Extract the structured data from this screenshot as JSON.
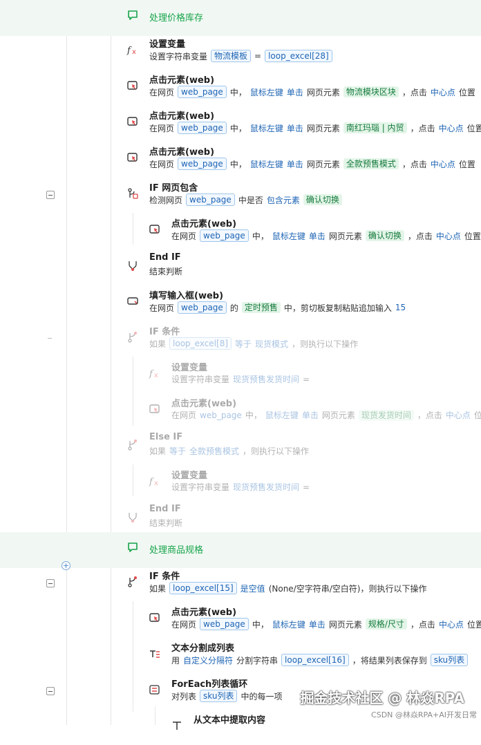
{
  "rows": [
    {
      "line": "56",
      "kind": "comment",
      "title": "处理价格库存"
    },
    {
      "line": "57",
      "title": "设置变量",
      "desc": [
        [
          "t",
          "设置字符串变量"
        ],
        [
          "v",
          "物流模板"
        ],
        [
          "t",
          "="
        ],
        [
          "v",
          "loop_excel[28]"
        ]
      ]
    },
    {
      "line": "58",
      "title": "点击元素(web)",
      "desc": [
        [
          "t",
          "在网页"
        ],
        [
          "v",
          "web_page"
        ],
        [
          "t",
          "中，"
        ],
        [
          "l",
          "鼠标左键"
        ],
        [
          "l",
          "单击"
        ],
        [
          "t",
          "网页元素"
        ],
        [
          "e",
          "物流模块区块"
        ],
        [
          "t",
          "，点击"
        ],
        [
          "l",
          "中心点"
        ],
        [
          "t",
          "位置"
        ]
      ]
    },
    {
      "line": "59",
      "title": "点击元素(web)",
      "desc": [
        [
          "t",
          "在网页"
        ],
        [
          "v",
          "web_page"
        ],
        [
          "t",
          "中，"
        ],
        [
          "l",
          "鼠标左键"
        ],
        [
          "l",
          "单击"
        ],
        [
          "t",
          "网页元素"
        ],
        [
          "e",
          "南红玛瑙 | 内贸"
        ],
        [
          "t",
          "，点击"
        ],
        [
          "l",
          "中心点"
        ],
        [
          "t",
          "位置"
        ]
      ]
    },
    {
      "line": "60",
      "title": "点击元素(web)",
      "desc": [
        [
          "t",
          "在网页"
        ],
        [
          "v",
          "web_page"
        ],
        [
          "t",
          "中，"
        ],
        [
          "l",
          "鼠标左键"
        ],
        [
          "l",
          "单击"
        ],
        [
          "t",
          "网页元素"
        ],
        [
          "e",
          "全款预售模式"
        ],
        [
          "t",
          "，点击"
        ],
        [
          "l",
          "中心点"
        ],
        [
          "t",
          "位置"
        ]
      ]
    },
    {
      "line": "61",
      "title": "IF 网页包含",
      "desc": [
        [
          "t",
          "检测网页"
        ],
        [
          "v",
          "web_page"
        ],
        [
          "t",
          "中是否"
        ],
        [
          "l",
          "包含元素"
        ],
        [
          "e",
          "确认切换"
        ]
      ]
    },
    {
      "line": "62",
      "title": "点击元素(web)",
      "desc": [
        [
          "t",
          "在网页"
        ],
        [
          "v",
          "web_page"
        ],
        [
          "t",
          "中，"
        ],
        [
          "l",
          "鼠标左键"
        ],
        [
          "l",
          "单击"
        ],
        [
          "t",
          "网页元素"
        ],
        [
          "e",
          "确认切换"
        ],
        [
          "t",
          "，点击"
        ],
        [
          "l",
          "中心点"
        ],
        [
          "t",
          "位置"
        ]
      ]
    },
    {
      "line": "63",
      "title": "End IF",
      "desc": [
        [
          "t",
          "结束判断"
        ]
      ]
    },
    {
      "line": "64",
      "title": "填写输入框(web)",
      "desc": [
        [
          "t",
          "在网页"
        ],
        [
          "v",
          "web_page"
        ],
        [
          "t",
          "的"
        ],
        [
          "e",
          "定时预售"
        ],
        [
          "t",
          "中，剪切板复制粘贴追加输入"
        ],
        [
          "l",
          "15"
        ]
      ]
    },
    {
      "line": "65",
      "title": "IF 条件",
      "desc": [
        [
          "t",
          "如果"
        ],
        [
          "v",
          "loop_excel[8]"
        ],
        [
          "l",
          "等于"
        ],
        [
          "l",
          "现货模式"
        ],
        [
          "t",
          "，则执行以下操作"
        ]
      ]
    },
    {
      "line": "66",
      "title": "设置变量",
      "desc": [
        [
          "t",
          "设置字符串变量"
        ],
        [
          "l",
          "现货预售发货时间"
        ],
        [
          "t",
          "="
        ]
      ]
    },
    {
      "line": "67",
      "title": "点击元素(web)",
      "desc": [
        [
          "t",
          "在网页"
        ],
        [
          "l",
          "web_page"
        ],
        [
          "t",
          "中，"
        ],
        [
          "l",
          "鼠标左键"
        ],
        [
          "l",
          "单击"
        ],
        [
          "t",
          "网页元素"
        ],
        [
          "e",
          "现货发货时间"
        ],
        [
          "t",
          "，点击"
        ],
        [
          "l",
          "中心点"
        ],
        [
          "t",
          "位置"
        ]
      ]
    },
    {
      "line": "68",
      "title": "Else IF",
      "desc": [
        [
          "t",
          "如果"
        ],
        [
          "l",
          "等于"
        ],
        [
          "l",
          "全款预售模式"
        ],
        [
          "t",
          "，则执行以下操作"
        ]
      ]
    },
    {
      "line": "69",
      "title": "设置变量",
      "desc": [
        [
          "t",
          "设置字符串变量"
        ],
        [
          "l",
          "现货预售发货时间"
        ],
        [
          "t",
          "="
        ]
      ]
    },
    {
      "line": "70",
      "title": "End IF",
      "desc": [
        [
          "t",
          "结束判断"
        ]
      ]
    },
    {
      "line": "71",
      "kind": "comment",
      "title": "处理商品规格"
    },
    {
      "line": "72",
      "title": "IF 条件",
      "desc": [
        [
          "t",
          "如果"
        ],
        [
          "v",
          "loop_excel[15]"
        ],
        [
          "l",
          "是空值"
        ],
        [
          "t",
          "(None/空字符串/空白符)，则执行以下操作"
        ]
      ]
    },
    {
      "line": "73",
      "title": "点击元素(web)",
      "desc": [
        [
          "t",
          "在网页"
        ],
        [
          "v",
          "web_page"
        ],
        [
          "t",
          "中，"
        ],
        [
          "l",
          "鼠标左键"
        ],
        [
          "l",
          "单击"
        ],
        [
          "t",
          "网页元素"
        ],
        [
          "e",
          "规格/尺寸"
        ],
        [
          "t",
          "，点击"
        ],
        [
          "l",
          "中心点"
        ],
        [
          "t",
          "位置"
        ]
      ]
    },
    {
      "line": "74",
      "title": "文本分割成列表",
      "desc": [
        [
          "t",
          "用"
        ],
        [
          "l",
          "自定义分隔符"
        ],
        [
          "t",
          "分割字符串"
        ],
        [
          "v",
          "loop_excel[16]"
        ],
        [
          "t",
          "，将结果列表保存到"
        ],
        [
          "v",
          "sku列表"
        ]
      ]
    },
    {
      "line": "75",
      "title": "ForEach列表循环",
      "desc": [
        [
          "t",
          "对列表"
        ],
        [
          "v",
          "sku列表"
        ],
        [
          "t",
          "中的每一项"
        ]
      ]
    },
    {
      "line": "76",
      "title": "从文本中提取内容",
      "desc": []
    }
  ],
  "watermark": "掘金技术社区 @ 林焱RPA",
  "footer": "CSDN @林焱RPA+AI开发日常"
}
